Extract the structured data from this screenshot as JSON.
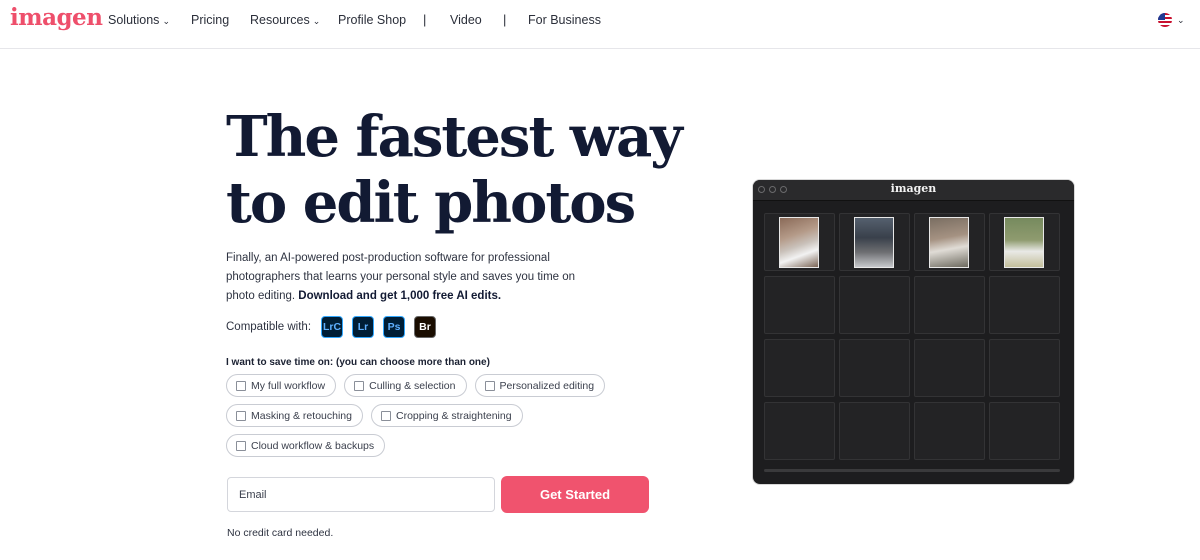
{
  "brand": {
    "logo": "imagen",
    "accent_color": "#f0536e"
  },
  "nav": {
    "solutions": "Solutions",
    "pricing": "Pricing",
    "resources": "Resources",
    "profile_shop": "Profile Shop",
    "separator": "|",
    "video": "Video",
    "for_business": "For Business",
    "dropdown_icon": "⌄",
    "language_icon": "us-flag-icon"
  },
  "hero": {
    "title_line1": "The fastest way",
    "title_line2": "to edit photos",
    "desc_plain": "Finally, an AI-powered post-production software for professional photographers that learns your personal style and saves you time on photo editing. ",
    "desc_bold": "Download and get 1,000 free AI edits."
  },
  "compat": {
    "label": "Compatible with:",
    "apps": [
      "LrC",
      "Lr",
      "Ps",
      "Br"
    ]
  },
  "form": {
    "question": "I want to save time on: (you can choose more than one)",
    "options": [
      "My full workflow",
      "Culling & selection",
      "Personalized editing",
      "Masking & retouching",
      "Cropping & straightening",
      "Cloud workflow & backups"
    ],
    "email_placeholder": "Email",
    "email_value": "",
    "cta": "Get Started",
    "note": "No credit card needed."
  },
  "app_window": {
    "title": "imagen"
  }
}
